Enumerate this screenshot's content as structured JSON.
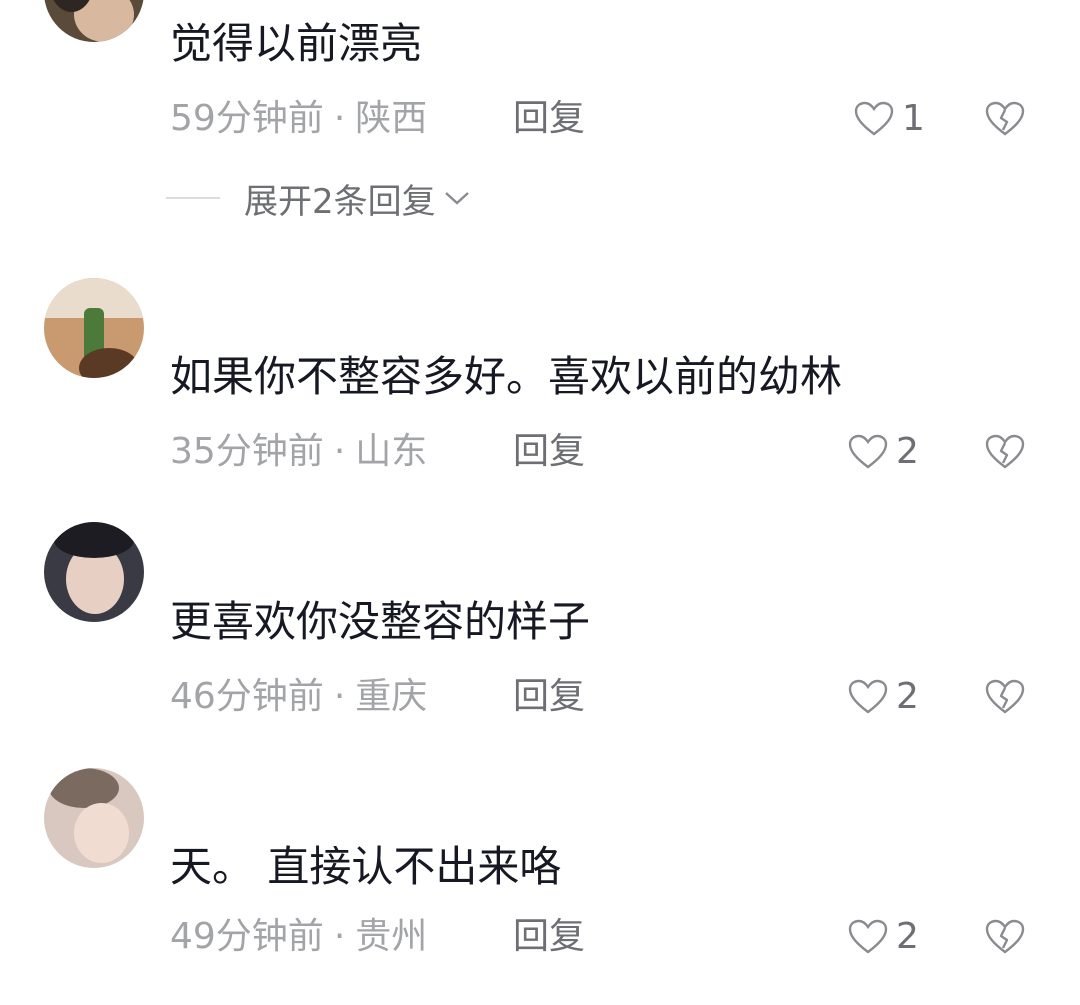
{
  "comments": [
    {
      "username": "",
      "text": "觉得以前漂亮",
      "time": "59分钟前",
      "location": "陕西",
      "reply_label": "回复",
      "likes": "1",
      "expand_label": "展开2条回复"
    },
    {
      "username": "",
      "text": "如果你不整容多好。喜欢以前的幼林",
      "time": "35分钟前",
      "location": "山东",
      "reply_label": "回复",
      "likes": "2"
    },
    {
      "username": "",
      "text": "更喜欢你没整容的样子",
      "time": "46分钟前",
      "location": "重庆",
      "reply_label": "回复",
      "likes": "2"
    },
    {
      "username": "",
      "text": "天。 直接认不出来咯",
      "time": "49分钟前",
      "location": "贵州",
      "reply_label": "回复",
      "likes": "2"
    }
  ],
  "separator": "·",
  "icons": {
    "like": "heart-outline-icon",
    "dislike": "broken-heart-icon",
    "expand": "chevron-down-icon"
  },
  "colors": {
    "text": "#161823",
    "meta": "#a3a4a8",
    "action": "#6e6f74"
  }
}
